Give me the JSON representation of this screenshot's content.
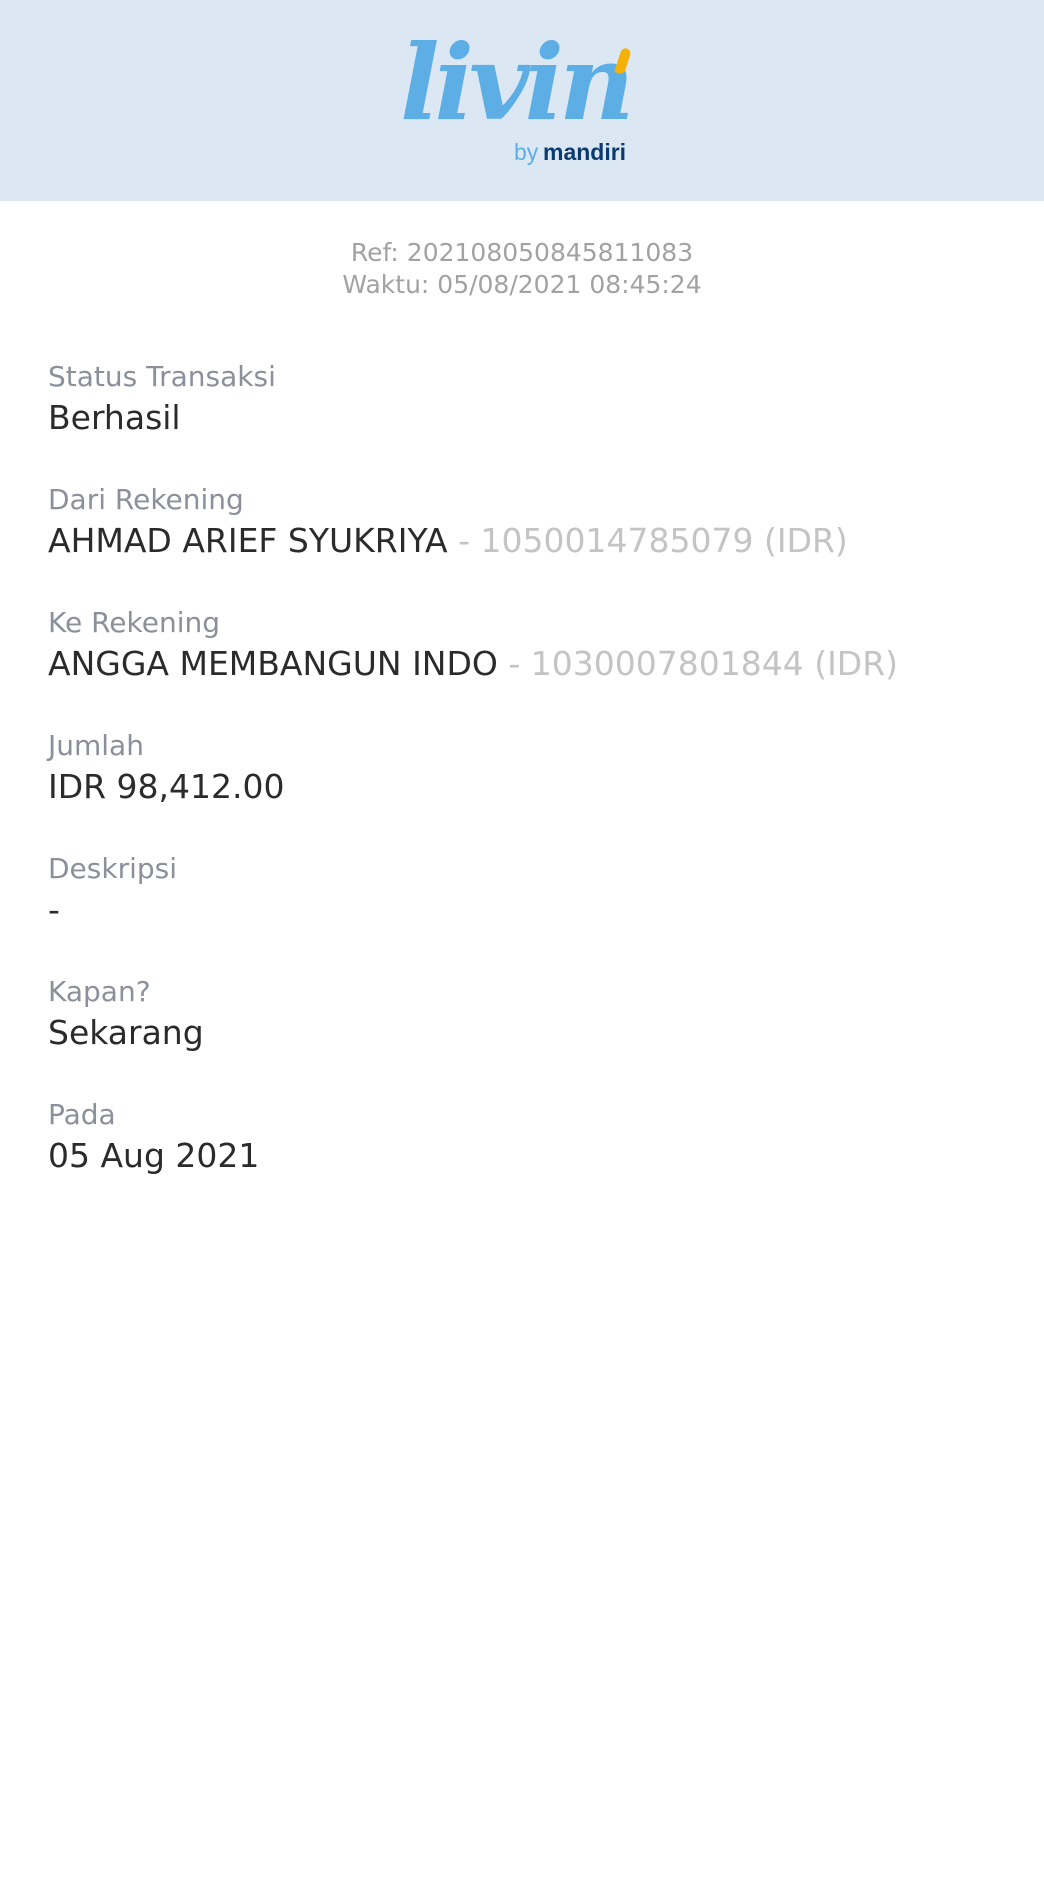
{
  "brand": {
    "wordmark": "livin",
    "by": "by",
    "bank": "mandiri",
    "colors": {
      "header_bg": "#dbe8f4",
      "wordmark": "#5eaee6",
      "accent": "#f5b10a",
      "bank": "#0b3a6e"
    }
  },
  "receipt": {
    "ref": "Ref: 202108050845811083",
    "time": "Waktu: 05/08/2021 08:45:24"
  },
  "fields": {
    "status": {
      "label": "Status Transaksi",
      "value": "Berhasil"
    },
    "from": {
      "label": "Dari Rekening",
      "name": "AHMAD ARIEF SYUKRIYA",
      "account": " - 1050014785079 (IDR)"
    },
    "to": {
      "label": "Ke Rekening",
      "name": "ANGGA MEMBANGUN INDO",
      "account": " - 1030007801844 (IDR)"
    },
    "amount": {
      "label": "Jumlah",
      "value": "IDR 98,412.00"
    },
    "description": {
      "label": "Deskripsi",
      "value": "-"
    },
    "when": {
      "label": "Kapan?",
      "value": "Sekarang"
    },
    "date": {
      "label": "Pada",
      "value": "05 Aug 2021"
    }
  }
}
